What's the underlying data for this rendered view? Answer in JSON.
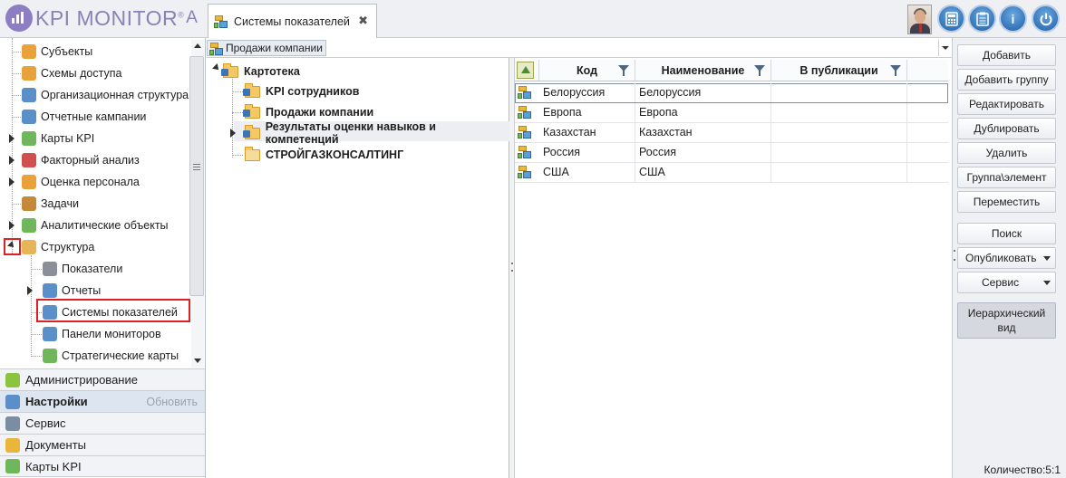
{
  "app": {
    "logo_text": "KPI MONITOR",
    "logo_reg": "®",
    "logo_tail": "A"
  },
  "tab": {
    "title": "Системы показателей",
    "close_glyph": "✖"
  },
  "header_buttons": {
    "grid_icon": "calculator-icon",
    "list_icon": "clipboard-icon",
    "info_label": "i",
    "power_icon": "power-icon"
  },
  "sidebar": {
    "items": [
      {
        "label": "Субъекты",
        "icon": "users-icon",
        "color": "#e9a23b"
      },
      {
        "label": "Схемы доступа",
        "icon": "access-scheme-icon",
        "color": "#e9a23b"
      },
      {
        "label": "Организационная структура",
        "icon": "org-structure-icon",
        "color": "#5a8fc9"
      },
      {
        "label": "Отчетные кампании",
        "icon": "report-campaign-icon",
        "color": "#5a8fc9"
      },
      {
        "label": "Карты KPI",
        "icon": "kpi-map-icon",
        "color": "#6fb75a"
      },
      {
        "label": "Факторный анализ",
        "icon": "factor-analysis-icon",
        "color": "#d04f4f"
      },
      {
        "label": "Оценка персонала",
        "icon": "staff-rating-icon",
        "color": "#e9a23b"
      },
      {
        "label": "Задачи",
        "icon": "tasks-icon",
        "color": "#c48a3a"
      },
      {
        "label": "Аналитические объекты",
        "icon": "analytics-objects-icon",
        "color": "#6fb75a"
      },
      {
        "label": "Структура",
        "icon": "structure-icon",
        "color": "#e6b55a"
      },
      {
        "label": "Показатели",
        "icon": "indicators-icon",
        "color": "#8a8f99"
      },
      {
        "label": "Отчеты",
        "icon": "reports-icon",
        "color": "#5a8fc9"
      },
      {
        "label": "Системы показателей",
        "icon": "indicator-systems-icon",
        "color": "#5a8fc9"
      },
      {
        "label": "Панели мониторов",
        "icon": "monitor-panels-icon",
        "color": "#5a8fc9"
      },
      {
        "label": "Стратегические карты",
        "icon": "strategy-maps-icon",
        "color": "#6fb75a"
      }
    ],
    "sections": [
      {
        "label": "Администрирование",
        "icon": "admin-icon",
        "color": "#8cc43f"
      },
      {
        "label": "Настройки",
        "icon": "settings-icon",
        "color": "#5a8fc9",
        "action": "Обновить"
      },
      {
        "label": "Сервис",
        "icon": "tools-icon",
        "color": "#7a8da3"
      },
      {
        "label": "Документы",
        "icon": "documents-icon",
        "color": "#e9b63b"
      },
      {
        "label": "Карты KPI",
        "icon": "kpi-cards-icon",
        "color": "#6fb75a"
      }
    ]
  },
  "filter_combo": {
    "value": "Продажи компании"
  },
  "catalog": {
    "root": "Картотека",
    "children": [
      "KPI сотрудников",
      "Продажи компании",
      "Результаты оценки навыков и компетенций",
      "СТРОЙГАЗКОНСАЛТИНГ"
    ]
  },
  "grid": {
    "columns": [
      "Код",
      "Наименование",
      "В публикации"
    ],
    "rows": [
      {
        "code": "Белоруссия",
        "name": "Белоруссия",
        "published": ""
      },
      {
        "code": "Европа",
        "name": "Европа",
        "published": ""
      },
      {
        "code": "Казахстан",
        "name": "Казахстан",
        "published": ""
      },
      {
        "code": "Россия",
        "name": "Россия",
        "published": ""
      },
      {
        "code": "США",
        "name": "США",
        "published": ""
      }
    ]
  },
  "actions": {
    "add": "Добавить",
    "add_group": "Добавить группу",
    "edit": "Редактировать",
    "duplicate": "Дублировать",
    "delete": "Удалить",
    "group_element": "Группа\\элемент",
    "move": "Переместить",
    "search": "Поиск",
    "publish": "Опубликовать",
    "service": "Сервис",
    "hierarchical_view": "Иерархический вид"
  },
  "status": {
    "count": "Количество:5:1"
  },
  "colors": {
    "accent_purple": "#8d7ec4",
    "highlight_red": "#e02020",
    "button_blue": "#1f5fa8"
  }
}
